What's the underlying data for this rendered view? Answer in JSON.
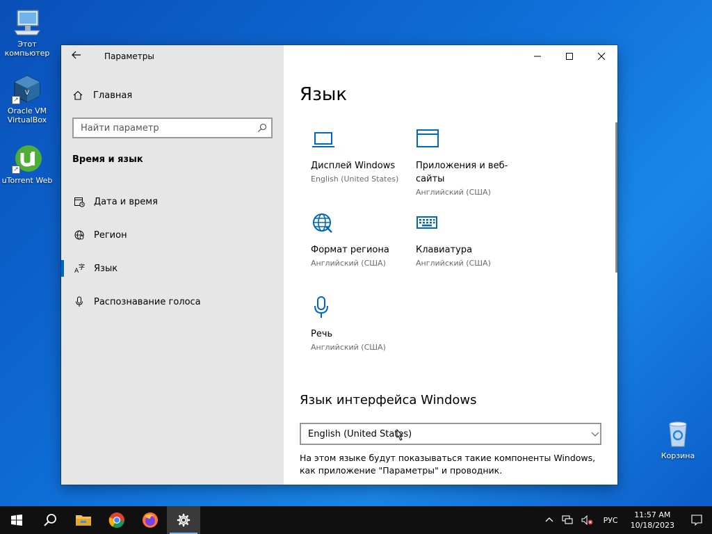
{
  "desktop": {
    "icons": [
      {
        "label": "Этот компьютер"
      },
      {
        "label": "Oracle VM VirtualBox"
      },
      {
        "label": "uTorrent Web"
      },
      {
        "label": "Корзина"
      }
    ]
  },
  "window": {
    "app_title": "Параметры",
    "sidebar": {
      "home_label": "Главная",
      "search_placeholder": "Найти параметр",
      "section_title": "Время и язык",
      "items": [
        {
          "label": "Дата и время",
          "icon": "calendar-clock-icon"
        },
        {
          "label": "Регион",
          "icon": "region-globe-icon"
        },
        {
          "label": "Язык",
          "icon": "language-icon",
          "active": true
        },
        {
          "label": "Распознавание голоса",
          "icon": "microphone-icon"
        }
      ]
    },
    "content": {
      "title": "Язык",
      "tiles": [
        {
          "name": "Дисплей Windows",
          "sub": "English (United States)",
          "icon": "laptop-icon"
        },
        {
          "name": "Приложения и веб-сайты",
          "sub": "Английский (США)",
          "icon": "window-icon"
        },
        {
          "name": "Формат региона",
          "sub": "Английский (США)",
          "icon": "globe-format-icon"
        },
        {
          "name": "Клавиатура",
          "sub": "Английский (США)",
          "icon": "keyboard-icon"
        },
        {
          "name": "Речь",
          "sub": "Английский (США)",
          "icon": "microphone-icon"
        }
      ],
      "interface_heading": "Язык интерфейса Windows",
      "interface_value": "English (United States)",
      "interface_desc": "На этом языке будут показываться такие компоненты Windows, как приложение \"Параметры\" и проводник."
    }
  },
  "taskbar": {
    "lang": "РУС",
    "time": "11:57 AM",
    "date": "10/18/2023"
  },
  "colors": {
    "accent": "#0067c0",
    "sidebar_bg": "#e6e6e6",
    "taskbar_bg": "#101010"
  }
}
